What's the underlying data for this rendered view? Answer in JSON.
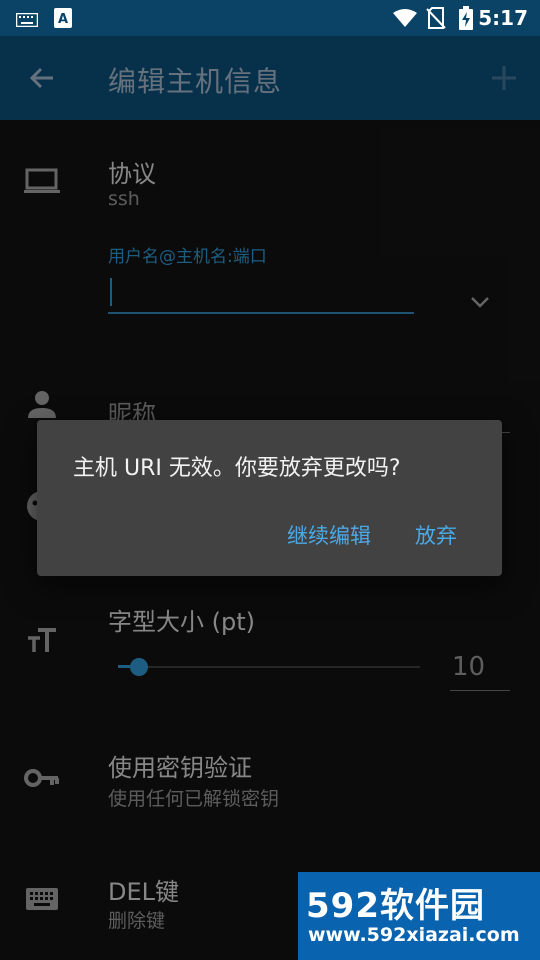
{
  "status_bar": {
    "time": "5:17",
    "icons": [
      "keyboard-icon",
      "a-badge-icon",
      "wifi-icon",
      "no-sim-icon",
      "battery-charging-icon"
    ]
  },
  "app_bar": {
    "title": "编辑主机信息",
    "back_icon": "arrow-back-icon",
    "add_icon": "plus-icon"
  },
  "protocol": {
    "label": "协议",
    "value": "ssh"
  },
  "uri_field": {
    "label": "用户名@主机名:端口",
    "value": ""
  },
  "nickname": {
    "label": "昵称"
  },
  "font_size": {
    "label": "字型大小 (pt)",
    "value": "10",
    "slider_fraction": 0.07
  },
  "key_auth": {
    "label": "使用密钥验证",
    "sub": "使用任何已解锁密钥"
  },
  "del_key": {
    "label": "DEL键",
    "sub": "删除键"
  },
  "dialog": {
    "message": "主机 URI 无效。你要放弃更改吗?",
    "continue_label": "继续编辑",
    "discard_label": "放弃"
  },
  "watermark": {
    "brand": "592软件园",
    "url": "www.592xiazai.com"
  },
  "colors": {
    "accent": "#2f8fc8",
    "app_bar": "#0c4a72",
    "background": "#121212",
    "dialog": "#424242"
  }
}
